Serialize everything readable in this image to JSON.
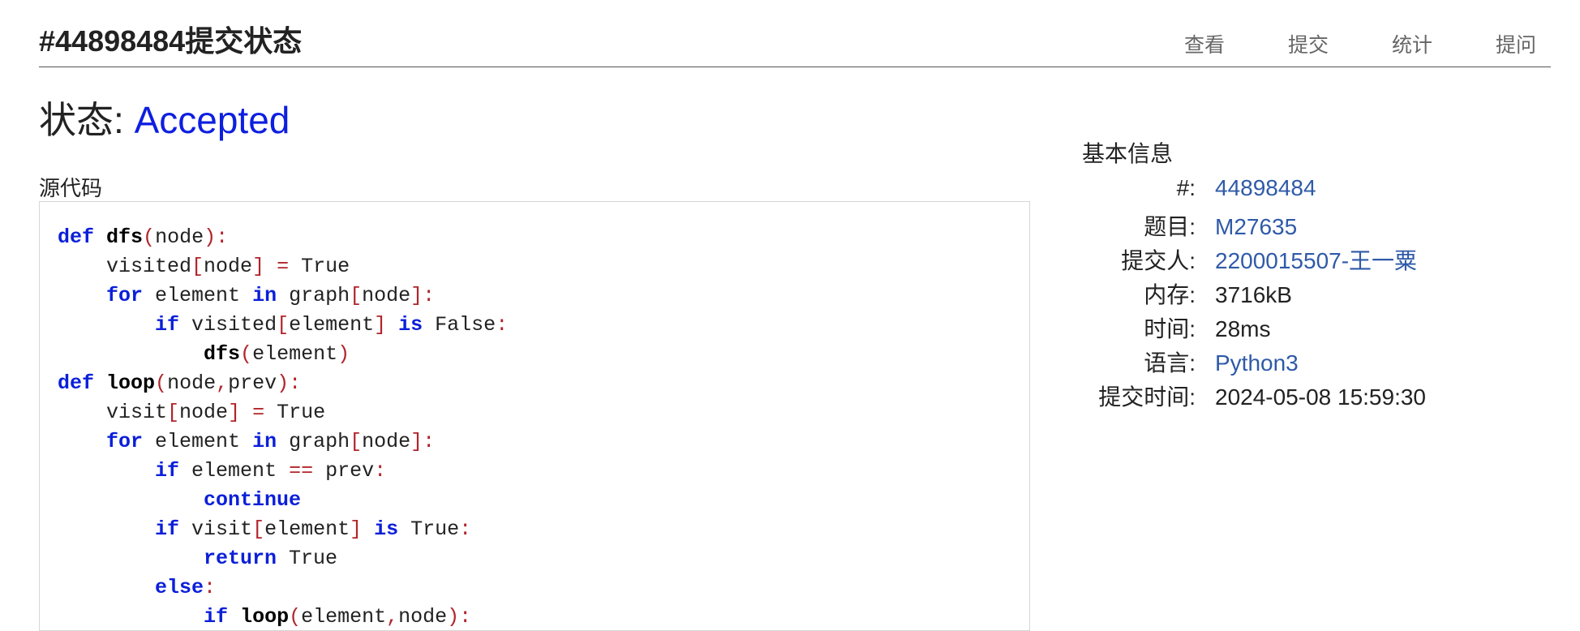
{
  "header": {
    "title": "#44898484提交状态",
    "nav": [
      "查看",
      "提交",
      "统计",
      "提问"
    ]
  },
  "status": {
    "label": "状态:",
    "value": "Accepted"
  },
  "source": {
    "label": "源代码",
    "lines": [
      [
        [
          "kw",
          "def"
        ],
        [
          "t",
          " "
        ],
        [
          "fn",
          "dfs"
        ],
        [
          "p",
          "("
        ],
        [
          "t",
          "node"
        ],
        [
          "p",
          "):"
        ]
      ],
      [
        [
          "t",
          "    visited"
        ],
        [
          "p",
          "["
        ],
        [
          "t",
          "node"
        ],
        [
          "p",
          "]"
        ],
        [
          "t",
          " "
        ],
        [
          "p",
          "="
        ],
        [
          "t",
          " True"
        ]
      ],
      [
        [
          "t",
          "    "
        ],
        [
          "kw",
          "for"
        ],
        [
          "t",
          " element "
        ],
        [
          "kw",
          "in"
        ],
        [
          "t",
          " graph"
        ],
        [
          "p",
          "["
        ],
        [
          "t",
          "node"
        ],
        [
          "p",
          "]:"
        ]
      ],
      [
        [
          "t",
          "        "
        ],
        [
          "kw",
          "if"
        ],
        [
          "t",
          " visited"
        ],
        [
          "p",
          "["
        ],
        [
          "t",
          "element"
        ],
        [
          "p",
          "]"
        ],
        [
          "t",
          " "
        ],
        [
          "kw",
          "is"
        ],
        [
          "t",
          " False"
        ],
        [
          "p",
          ":"
        ]
      ],
      [
        [
          "t",
          "            "
        ],
        [
          "fn",
          "dfs"
        ],
        [
          "p",
          "("
        ],
        [
          "t",
          "element"
        ],
        [
          "p",
          ")"
        ]
      ],
      [
        [
          "kw",
          "def"
        ],
        [
          "t",
          " "
        ],
        [
          "fn",
          "loop"
        ],
        [
          "p",
          "("
        ],
        [
          "t",
          "node"
        ],
        [
          "p",
          ","
        ],
        [
          "t",
          "prev"
        ],
        [
          "p",
          "):"
        ]
      ],
      [
        [
          "t",
          "    visit"
        ],
        [
          "p",
          "["
        ],
        [
          "t",
          "node"
        ],
        [
          "p",
          "]"
        ],
        [
          "t",
          " "
        ],
        [
          "p",
          "="
        ],
        [
          "t",
          " True"
        ]
      ],
      [
        [
          "t",
          "    "
        ],
        [
          "kw",
          "for"
        ],
        [
          "t",
          " element "
        ],
        [
          "kw",
          "in"
        ],
        [
          "t",
          " graph"
        ],
        [
          "p",
          "["
        ],
        [
          "t",
          "node"
        ],
        [
          "p",
          "]:"
        ]
      ],
      [
        [
          "t",
          "        "
        ],
        [
          "kw",
          "if"
        ],
        [
          "t",
          " element "
        ],
        [
          "p",
          "=="
        ],
        [
          "t",
          " prev"
        ],
        [
          "p",
          ":"
        ]
      ],
      [
        [
          "t",
          "            "
        ],
        [
          "kw",
          "continue"
        ]
      ],
      [
        [
          "t",
          "        "
        ],
        [
          "kw",
          "if"
        ],
        [
          "t",
          " visit"
        ],
        [
          "p",
          "["
        ],
        [
          "t",
          "element"
        ],
        [
          "p",
          "]"
        ],
        [
          "t",
          " "
        ],
        [
          "kw",
          "is"
        ],
        [
          "t",
          " True"
        ],
        [
          "p",
          ":"
        ]
      ],
      [
        [
          "t",
          "            "
        ],
        [
          "kw",
          "return"
        ],
        [
          "t",
          " True"
        ]
      ],
      [
        [
          "t",
          "        "
        ],
        [
          "kw",
          "else"
        ],
        [
          "p",
          ":"
        ]
      ],
      [
        [
          "t",
          "            "
        ],
        [
          "kw",
          "if"
        ],
        [
          "t",
          " "
        ],
        [
          "fn",
          "loop"
        ],
        [
          "p",
          "("
        ],
        [
          "t",
          "element"
        ],
        [
          "p",
          ","
        ],
        [
          "t",
          "node"
        ],
        [
          "p",
          "):"
        ]
      ]
    ]
  },
  "info": {
    "title": "基本信息",
    "rows": [
      {
        "key": "#:",
        "value": "44898484",
        "link": true
      },
      {
        "key": "题目:",
        "value": "M27635",
        "link": true
      },
      {
        "key": "提交人:",
        "value": "2200015507-王一粟",
        "link": true
      },
      {
        "key": "内存:",
        "value": "3716kB",
        "link": false
      },
      {
        "key": "时间:",
        "value": "28ms",
        "link": false
      },
      {
        "key": "语言:",
        "value": "Python3",
        "link": true
      },
      {
        "key": "提交时间:",
        "value": "2024-05-08 15:59:30",
        "link": false
      }
    ]
  }
}
